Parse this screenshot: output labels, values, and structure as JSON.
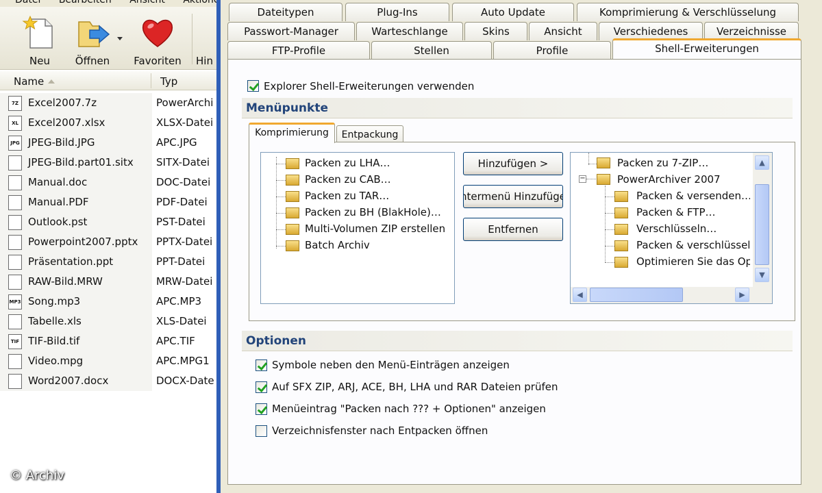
{
  "explorer": {
    "menu": [
      "Datei",
      "Bearbeiten",
      "Ansicht",
      "Aktionen"
    ],
    "toolbar": [
      {
        "label": "Neu",
        "icon": "new-document-icon"
      },
      {
        "label": "Öffnen",
        "icon": "open-folder-icon"
      },
      {
        "label": "Favoriten",
        "icon": "heart-icon"
      },
      {
        "label": "Hin",
        "icon": "add-icon"
      }
    ],
    "columns": {
      "name": "Name",
      "type": "Typ"
    },
    "files": [
      {
        "name": "Excel2007.7z",
        "type": "PowerArchi",
        "badge": "7Z"
      },
      {
        "name": "Excel2007.xlsx",
        "type": "XLSX-Datei",
        "badge": "XL"
      },
      {
        "name": "JPEG-Bild.JPG",
        "type": "APC.JPG",
        "badge": "JPG"
      },
      {
        "name": "JPEG-Bild.part01.sitx",
        "type": "SITX-Datei",
        "badge": ""
      },
      {
        "name": "Manual.doc",
        "type": "DOC-Datei",
        "badge": ""
      },
      {
        "name": "Manual.PDF",
        "type": "PDF-Datei",
        "badge": ""
      },
      {
        "name": "Outlook.pst",
        "type": "PST-Datei",
        "badge": ""
      },
      {
        "name": "Powerpoint2007.pptx",
        "type": "PPTX-Datei",
        "badge": ""
      },
      {
        "name": "Präsentation.ppt",
        "type": "PPT-Datei",
        "badge": ""
      },
      {
        "name": "RAW-Bild.MRW",
        "type": "MRW-Datei",
        "badge": ""
      },
      {
        "name": "Song.mp3",
        "type": "APC.MP3",
        "badge": "MP3"
      },
      {
        "name": "Tabelle.xls",
        "type": "XLS-Datei",
        "badge": ""
      },
      {
        "name": "TIF-Bild.tif",
        "type": "APC.TIF",
        "badge": "TIF"
      },
      {
        "name": "Video.mpg",
        "type": "APC.MPG1",
        "badge": ""
      },
      {
        "name": "Word2007.docx",
        "type": "DOCX-Date",
        "badge": ""
      }
    ],
    "copyright": "© Archiv"
  },
  "dialog": {
    "tabs_row1": [
      "Dateitypen",
      "Plug-Ins",
      "Auto Update",
      "Komprimierung & Verschlüsselung"
    ],
    "tabs_row2": [
      "Passwort-Manager",
      "Warteschlange",
      "Skins",
      "Ansicht",
      "Verschiedenes",
      "Verzeichnisse"
    ],
    "tabs_row3": [
      "FTP-Profile",
      "Stellen",
      "Profile",
      "Shell-Erweiterungen"
    ],
    "use_shell_ext": {
      "label": "Explorer Shell-Erweiterungen verwenden",
      "checked": true
    },
    "menu_group": "Menüpunkte",
    "subtabs": [
      "Komprimierung",
      "Entpackung"
    ],
    "available_items": [
      "Packen zu LHA…",
      "Packen zu CAB…",
      "Packen zu TAR…",
      "Packen zu BH (BlakHole)…",
      "Multi-Volumen ZIP erstellen",
      "Batch Archiv"
    ],
    "buttons": {
      "add": "Hinzufügen >",
      "add_submenu": "Untermenü Hinzufügen",
      "remove": "Entfernen"
    },
    "selected_tree": {
      "top_item": "Packen zu 7-ZIP…",
      "group": "PowerArchiver 2007",
      "children": [
        "Packen & versenden…",
        "Packen & FTP…",
        "Verschlüsseln…",
        "Packen & verschlüsseln",
        "Optimieren Sie das Ope"
      ]
    },
    "options_group": "Optionen",
    "options": [
      {
        "label": "Symbole neben den Menü-Einträgen anzeigen",
        "checked": true
      },
      {
        "label": "Auf SFX ZIP, ARJ, ACE, BH, LHA und RAR Dateien prüfen",
        "checked": true
      },
      {
        "label": "Menüeintrag \"Packen nach ??? + Optionen\" anzeigen",
        "checked": true
      },
      {
        "label": "Verzeichnisfenster nach Entpacken öffnen",
        "checked": false
      }
    ]
  }
}
